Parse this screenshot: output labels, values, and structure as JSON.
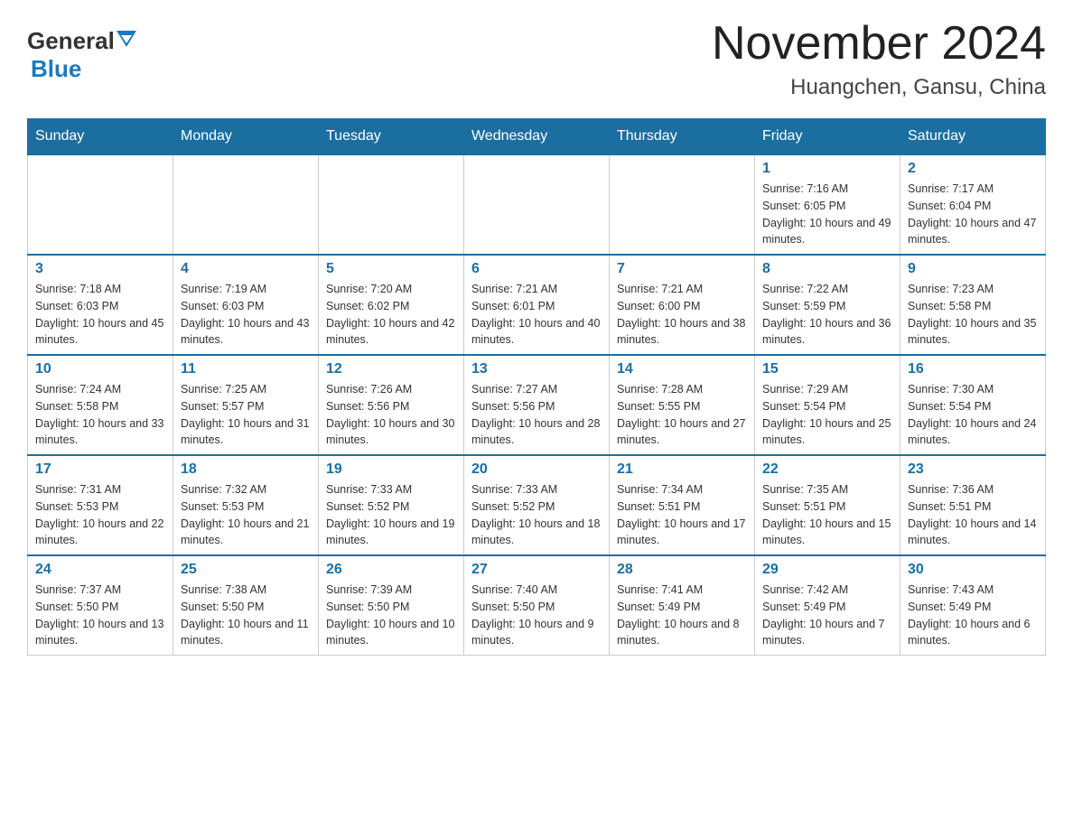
{
  "header": {
    "logo_general": "General",
    "logo_blue": "Blue",
    "month_title": "November 2024",
    "location": "Huangchen, Gansu, China"
  },
  "weekdays": [
    "Sunday",
    "Monday",
    "Tuesday",
    "Wednesday",
    "Thursday",
    "Friday",
    "Saturday"
  ],
  "weeks": [
    [
      {
        "day": "",
        "info": ""
      },
      {
        "day": "",
        "info": ""
      },
      {
        "day": "",
        "info": ""
      },
      {
        "day": "",
        "info": ""
      },
      {
        "day": "",
        "info": ""
      },
      {
        "day": "1",
        "info": "Sunrise: 7:16 AM\nSunset: 6:05 PM\nDaylight: 10 hours and 49 minutes."
      },
      {
        "day": "2",
        "info": "Sunrise: 7:17 AM\nSunset: 6:04 PM\nDaylight: 10 hours and 47 minutes."
      }
    ],
    [
      {
        "day": "3",
        "info": "Sunrise: 7:18 AM\nSunset: 6:03 PM\nDaylight: 10 hours and 45 minutes."
      },
      {
        "day": "4",
        "info": "Sunrise: 7:19 AM\nSunset: 6:03 PM\nDaylight: 10 hours and 43 minutes."
      },
      {
        "day": "5",
        "info": "Sunrise: 7:20 AM\nSunset: 6:02 PM\nDaylight: 10 hours and 42 minutes."
      },
      {
        "day": "6",
        "info": "Sunrise: 7:21 AM\nSunset: 6:01 PM\nDaylight: 10 hours and 40 minutes."
      },
      {
        "day": "7",
        "info": "Sunrise: 7:21 AM\nSunset: 6:00 PM\nDaylight: 10 hours and 38 minutes."
      },
      {
        "day": "8",
        "info": "Sunrise: 7:22 AM\nSunset: 5:59 PM\nDaylight: 10 hours and 36 minutes."
      },
      {
        "day": "9",
        "info": "Sunrise: 7:23 AM\nSunset: 5:58 PM\nDaylight: 10 hours and 35 minutes."
      }
    ],
    [
      {
        "day": "10",
        "info": "Sunrise: 7:24 AM\nSunset: 5:58 PM\nDaylight: 10 hours and 33 minutes."
      },
      {
        "day": "11",
        "info": "Sunrise: 7:25 AM\nSunset: 5:57 PM\nDaylight: 10 hours and 31 minutes."
      },
      {
        "day": "12",
        "info": "Sunrise: 7:26 AM\nSunset: 5:56 PM\nDaylight: 10 hours and 30 minutes."
      },
      {
        "day": "13",
        "info": "Sunrise: 7:27 AM\nSunset: 5:56 PM\nDaylight: 10 hours and 28 minutes."
      },
      {
        "day": "14",
        "info": "Sunrise: 7:28 AM\nSunset: 5:55 PM\nDaylight: 10 hours and 27 minutes."
      },
      {
        "day": "15",
        "info": "Sunrise: 7:29 AM\nSunset: 5:54 PM\nDaylight: 10 hours and 25 minutes."
      },
      {
        "day": "16",
        "info": "Sunrise: 7:30 AM\nSunset: 5:54 PM\nDaylight: 10 hours and 24 minutes."
      }
    ],
    [
      {
        "day": "17",
        "info": "Sunrise: 7:31 AM\nSunset: 5:53 PM\nDaylight: 10 hours and 22 minutes."
      },
      {
        "day": "18",
        "info": "Sunrise: 7:32 AM\nSunset: 5:53 PM\nDaylight: 10 hours and 21 minutes."
      },
      {
        "day": "19",
        "info": "Sunrise: 7:33 AM\nSunset: 5:52 PM\nDaylight: 10 hours and 19 minutes."
      },
      {
        "day": "20",
        "info": "Sunrise: 7:33 AM\nSunset: 5:52 PM\nDaylight: 10 hours and 18 minutes."
      },
      {
        "day": "21",
        "info": "Sunrise: 7:34 AM\nSunset: 5:51 PM\nDaylight: 10 hours and 17 minutes."
      },
      {
        "day": "22",
        "info": "Sunrise: 7:35 AM\nSunset: 5:51 PM\nDaylight: 10 hours and 15 minutes."
      },
      {
        "day": "23",
        "info": "Sunrise: 7:36 AM\nSunset: 5:51 PM\nDaylight: 10 hours and 14 minutes."
      }
    ],
    [
      {
        "day": "24",
        "info": "Sunrise: 7:37 AM\nSunset: 5:50 PM\nDaylight: 10 hours and 13 minutes."
      },
      {
        "day": "25",
        "info": "Sunrise: 7:38 AM\nSunset: 5:50 PM\nDaylight: 10 hours and 11 minutes."
      },
      {
        "day": "26",
        "info": "Sunrise: 7:39 AM\nSunset: 5:50 PM\nDaylight: 10 hours and 10 minutes."
      },
      {
        "day": "27",
        "info": "Sunrise: 7:40 AM\nSunset: 5:50 PM\nDaylight: 10 hours and 9 minutes."
      },
      {
        "day": "28",
        "info": "Sunrise: 7:41 AM\nSunset: 5:49 PM\nDaylight: 10 hours and 8 minutes."
      },
      {
        "day": "29",
        "info": "Sunrise: 7:42 AM\nSunset: 5:49 PM\nDaylight: 10 hours and 7 minutes."
      },
      {
        "day": "30",
        "info": "Sunrise: 7:43 AM\nSunset: 5:49 PM\nDaylight: 10 hours and 6 minutes."
      }
    ]
  ],
  "colors": {
    "header_bg": "#1a6fa0",
    "day_number": "#1a6fa0"
  }
}
